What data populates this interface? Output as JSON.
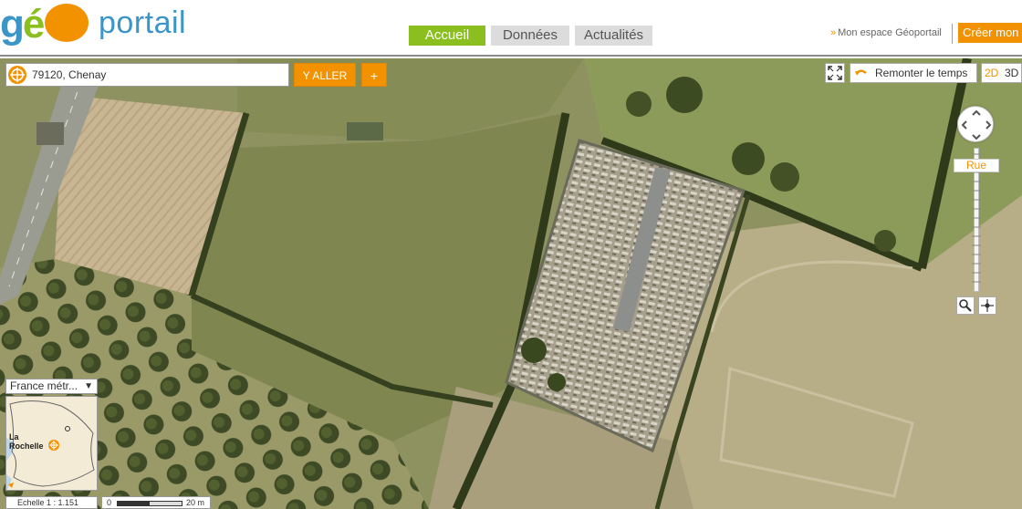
{
  "header": {
    "logo_geo": "géo",
    "logo_portail": "portail",
    "nav": [
      {
        "label": "Accueil",
        "active": true
      },
      {
        "label": "Données",
        "active": false
      },
      {
        "label": "Actualités",
        "active": false
      }
    ],
    "mon_espace": "Mon espace Géoportail",
    "creer": "Créer mon"
  },
  "search": {
    "value": "79120, Chenay",
    "yaller": "Y ALLER",
    "plus": "+"
  },
  "controls": {
    "remonter": "Remonter le temps",
    "mode_2d": "2D",
    "mode_3d": "3D",
    "zoom_label": "Rue"
  },
  "minimap": {
    "selector": "France métr...",
    "city_line1": "La",
    "city_line2": "Rochelle"
  },
  "scale": {
    "echelle": "Echelle 1 :  1.151",
    "start": "0",
    "end": "20 m"
  },
  "colors": {
    "accent": "#f39200",
    "nav_active": "#8bbf1f",
    "logo_blue": "#3b95c6"
  }
}
